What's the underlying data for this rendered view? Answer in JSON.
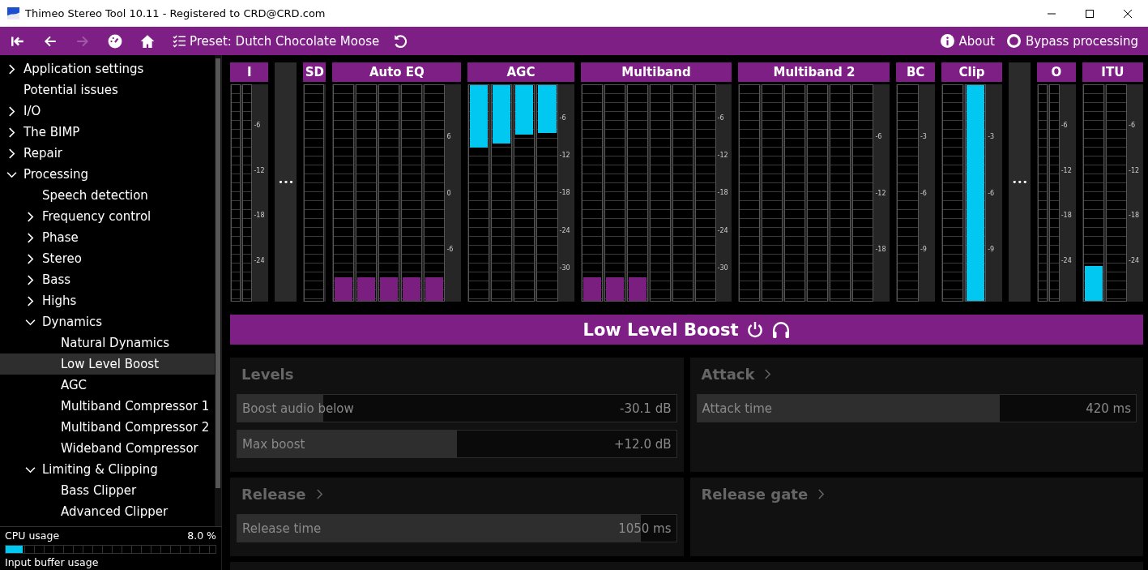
{
  "window": {
    "title": "Thimeo Stereo Tool 10.11 - Registered to CRD@CRD.com"
  },
  "toolbar": {
    "buttons": [
      {
        "kind": "first",
        "disabled": false
      },
      {
        "kind": "back",
        "disabled": false
      },
      {
        "kind": "forward",
        "disabled": true
      },
      {
        "kind": "gauge",
        "disabled": false
      },
      {
        "kind": "home",
        "disabled": false
      }
    ],
    "preset": "Preset: Dutch Chocolate Moose",
    "about": "About",
    "bypass": {
      "label": "Bypass processing",
      "on": false
    }
  },
  "sidebar": {
    "items": [
      {
        "label": "Application settings",
        "expanded": false,
        "selected": false
      },
      {
        "label": "Potential issues",
        "selected": false
      },
      {
        "label": "I/O",
        "expanded": false,
        "selected": false
      },
      {
        "label": "The BIMP",
        "expanded": false,
        "selected": false
      },
      {
        "label": "Repair",
        "expanded": false,
        "selected": false
      },
      {
        "label": "Processing",
        "expanded": true,
        "selected": false,
        "children": [
          {
            "label": "Speech detection",
            "selected": false
          },
          {
            "label": "Frequency control",
            "expanded": false,
            "selected": false
          },
          {
            "label": "Phase",
            "expanded": false,
            "selected": false
          },
          {
            "label": "Stereo",
            "expanded": false,
            "selected": false
          },
          {
            "label": "Bass",
            "expanded": false,
            "selected": false
          },
          {
            "label": "Highs",
            "expanded": false,
            "selected": false
          },
          {
            "label": "Dynamics",
            "expanded": true,
            "selected": false,
            "children": [
              {
                "label": "Natural Dynamics",
                "selected": false
              },
              {
                "label": "Low Level Boost",
                "selected": true
              },
              {
                "label": "AGC",
                "selected": false
              },
              {
                "label": "Multiband Compressor 1",
                "selected": false
              },
              {
                "label": "Multiband Compressor 2",
                "selected": false
              },
              {
                "label": "Wideband Compressor",
                "selected": false
              }
            ]
          },
          {
            "label": "Limiting & Clipping",
            "expanded": true,
            "selected": false,
            "children": [
              {
                "label": "Bass Clipper",
                "selected": false
              },
              {
                "label": "Advanced Clipper",
                "selected": false
              }
            ]
          }
        ]
      }
    ],
    "cpu": {
      "label": "CPU usage",
      "value": "8.0 %",
      "level": 0.08
    },
    "buffer": {
      "label": "Input buffer usage"
    }
  },
  "meters": [
    {
      "kind": "thin",
      "label": "I",
      "scale": [
        "-6",
        "-12",
        "-18",
        "-24"
      ],
      "bars": [
        {
          "kind": "empty"
        },
        {
          "kind": "empty"
        }
      ]
    },
    {
      "kind": "more",
      "label": "•••"
    },
    {
      "kind": "meter",
      "label": "SD",
      "bars": [
        {
          "kind": "empty"
        }
      ]
    },
    {
      "kind": "meter",
      "label": "Auto EQ",
      "scale": [
        "6",
        "0",
        "-6"
      ],
      "bars": [
        {
          "kind": "base",
          "level": 0.11
        },
        {
          "kind": "base",
          "level": 0.11
        },
        {
          "kind": "base",
          "level": 0.11
        },
        {
          "kind": "base",
          "level": 0.11
        },
        {
          "kind": "base",
          "level": 0.11
        }
      ]
    },
    {
      "kind": "meter",
      "label": "AGC",
      "scale": [
        "-6",
        "-12",
        "-18",
        "-24",
        "-30"
      ],
      "bars": [
        {
          "kind": "top",
          "level": 0.29
        },
        {
          "kind": "top",
          "level": 0.27
        },
        {
          "kind": "top",
          "level": 0.23
        },
        {
          "kind": "top",
          "level": 0.22
        }
      ]
    },
    {
      "kind": "meter",
      "label": "Multiband",
      "scale": [
        "-6",
        "-12",
        "-18",
        "-24",
        "-30"
      ],
      "bars": [
        {
          "kind": "base",
          "level": 0.11
        },
        {
          "kind": "base",
          "level": 0.11
        },
        {
          "kind": "base",
          "level": 0.11
        },
        {
          "kind": "empty"
        },
        {
          "kind": "empty"
        },
        {
          "kind": "empty"
        }
      ]
    },
    {
      "kind": "meter",
      "label": "Multiband 2",
      "scale": [
        "-6",
        "-12",
        "-18"
      ],
      "bars": [
        {
          "kind": "empty"
        },
        {
          "kind": "empty"
        },
        {
          "kind": "empty"
        },
        {
          "kind": "empty"
        },
        {
          "kind": "empty"
        },
        {
          "kind": "empty"
        }
      ]
    },
    {
      "kind": "meter",
      "label": "BC",
      "scale": [
        "-3",
        "-6",
        "-9"
      ],
      "bars": [
        {
          "kind": "empty"
        }
      ]
    },
    {
      "kind": "meter",
      "label": "Clip",
      "scale": [
        "-3",
        "-6",
        "-9"
      ],
      "bars": [
        {
          "kind": "empty"
        },
        {
          "kind": "bottom",
          "level": 1
        }
      ]
    },
    {
      "kind": "more",
      "label": "•••"
    },
    {
      "kind": "thin",
      "label": "O",
      "scale": [
        "-6",
        "-12",
        "-18",
        "-24"
      ],
      "bars": [
        {
          "kind": "empty"
        },
        {
          "kind": "empty"
        }
      ]
    },
    {
      "kind": "meter",
      "label": "ITU",
      "scale": [
        "-6",
        "-12",
        "-18",
        "-24"
      ],
      "bars": [
        {
          "kind": "bottom",
          "level": 0.16
        },
        {
          "kind": "empty"
        }
      ]
    }
  ],
  "section": {
    "title": "Low Level Boost",
    "panels": [
      {
        "title": "Levels",
        "expandable": false,
        "sliders": [
          {
            "label": "Boost audio below",
            "value": "-30.1 dB",
            "level": 0.195
          },
          {
            "label": "Max boost",
            "value": "+12.0 dB",
            "level": 0.5
          }
        ]
      },
      {
        "title": "Attack",
        "expandable": true,
        "sliders": [
          {
            "label": "Attack time",
            "value": "420 ms",
            "level": 0.69
          }
        ]
      },
      {
        "title": "Release",
        "expandable": true,
        "sliders": [
          {
            "label": "Release time",
            "value": "1050 ms",
            "level": 0.92
          }
        ]
      },
      {
        "title": "Release gate",
        "expandable": true
      }
    ]
  }
}
